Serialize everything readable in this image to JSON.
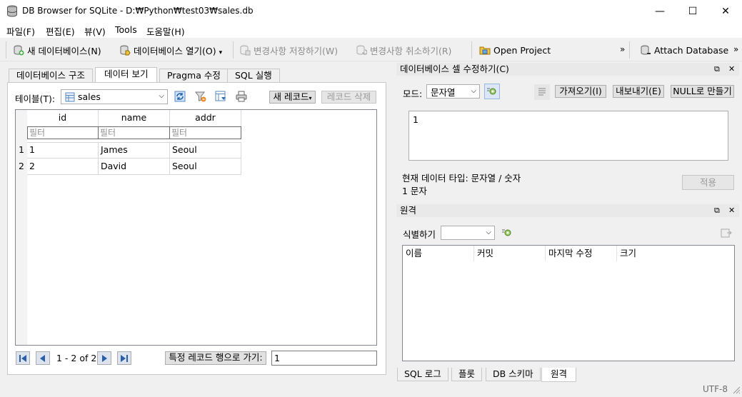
{
  "window": {
    "title": "DB Browser for SQLite - D:₩Python₩test03₩sales.db",
    "minimize_glyph": "—",
    "maximize_glyph": "☐",
    "close_glyph": "✕"
  },
  "menu": [
    "파일(F)",
    "편집(E)",
    "뷰(V)",
    "Tools",
    "도움말(H)"
  ],
  "toolbar": {
    "new_db": "새 데이터베이스(N)",
    "open_db": "데이터베이스 열기(O)",
    "write_changes": "변경사항 저장하기(W)",
    "revert_changes": "변경사항 취소하기(R)",
    "open_project": "Open Project",
    "attach_db": "Attach Database",
    "overflow": "»"
  },
  "main_tabs": [
    "데이터베이스 구조",
    "데이터 보기",
    "Pragma 수정",
    "SQL 실행"
  ],
  "browse": {
    "table_label": "테이블(T):",
    "table_value": "sales",
    "new_record": "새 레코드",
    "delete_record": "레코드 삭제",
    "columns": [
      "id",
      "name",
      "addr"
    ],
    "filter_placeholder": "필터",
    "rows": [
      {
        "num": "1",
        "id": "1",
        "name": "James",
        "addr": "Seoul"
      },
      {
        "num": "2",
        "id": "2",
        "name": "David",
        "addr": "Seoul"
      }
    ],
    "page_info": "1 - 2 of 2",
    "goto_label": "특정 레코드 행으로 가기:",
    "goto_value": "1"
  },
  "edit_cell": {
    "title": "데이터베이스 셀 수정하기(C)",
    "mode_label": "모드:",
    "mode_value": "문자열",
    "import": "가져오기(I)",
    "export": "내보내기(E)",
    "set_null": "NULL로 만들기",
    "content": "1",
    "type_info": "현재 데이터 타입: 문자열 / 숫자",
    "size_info": "1 문자",
    "apply": "적용"
  },
  "remote": {
    "title": "원격",
    "identity_label": "식별하기",
    "identity_value": "",
    "columns": [
      "이름",
      "커밋",
      "마지막 수정",
      "크기"
    ]
  },
  "bottom_tabs": [
    "SQL 로그",
    "플롯",
    "DB 스키마",
    "원격"
  ],
  "status": {
    "encoding": "UTF-8"
  }
}
